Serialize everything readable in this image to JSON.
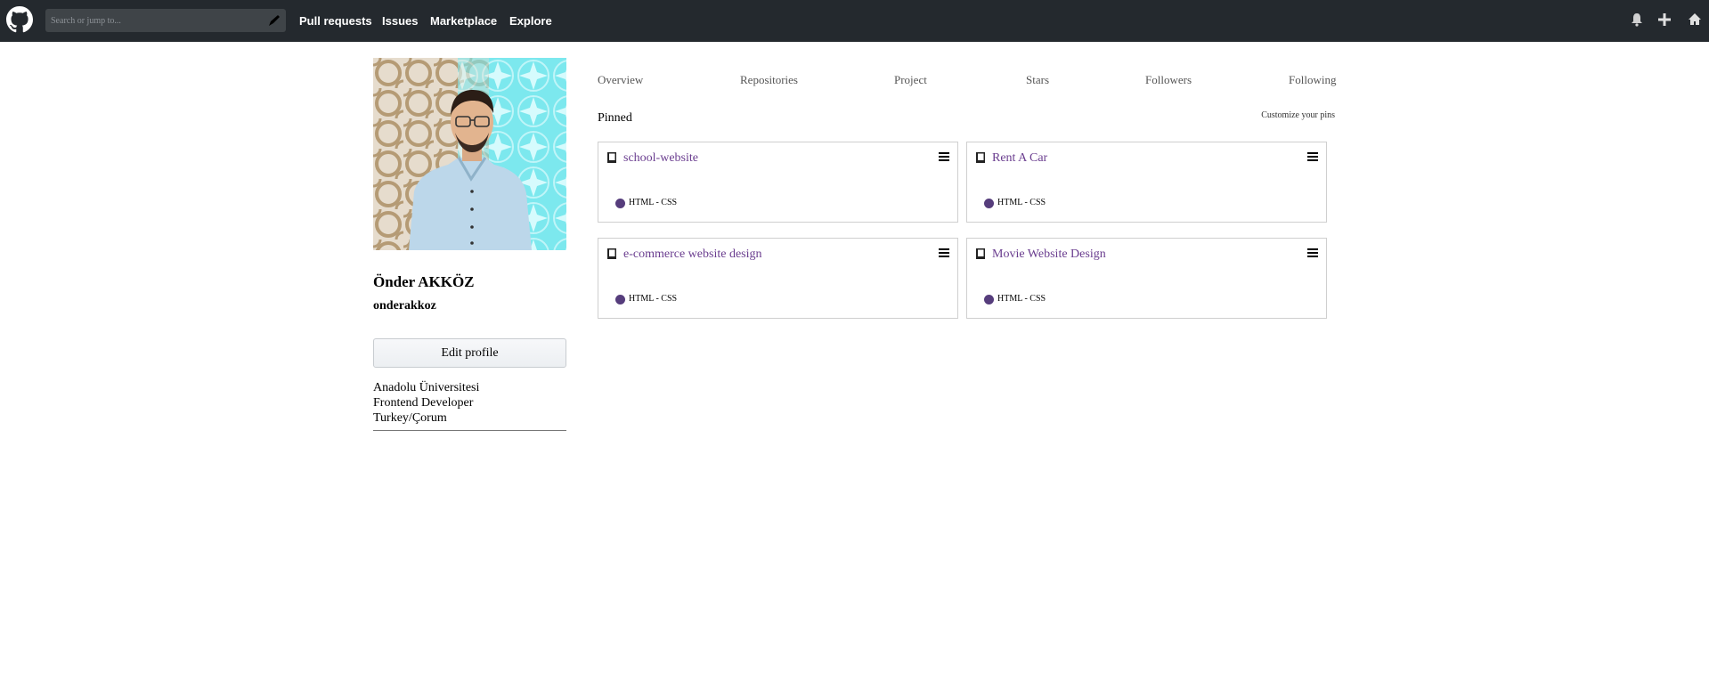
{
  "topbar": {
    "search_placeholder": "Search or jump to...",
    "nav": [
      "Pull requests",
      "Issues",
      "Marketplace",
      "Explore"
    ],
    "icons": [
      "bell-icon",
      "plus-icon",
      "home-icon"
    ]
  },
  "profile": {
    "fullname": "Önder AKKÖZ",
    "username": "onderakkoz",
    "edit_label": "Edit profile",
    "bio": [
      "Anadolu Üniversitesi",
      "Frontend Developer",
      "Turkey/Çorum"
    ]
  },
  "tabs": [
    "Overview",
    "Repositories",
    "Project",
    "Stars",
    "Followers",
    "Following"
  ],
  "pinned": {
    "title": "Pinned",
    "customize": "Customize your pins",
    "repos": [
      {
        "name": "school-website",
        "language": "HTML - CSS"
      },
      {
        "name": "Rent A Car",
        "language": "HTML - CSS"
      },
      {
        "name": "e-commerce website design",
        "language": "HTML - CSS"
      },
      {
        "name": "Movie Website Design",
        "language": "HTML - CSS"
      }
    ]
  },
  "colors": {
    "topbar": "#24292e",
    "repo_link": "#6a3d8f",
    "lang_dot": "#563d7c"
  }
}
